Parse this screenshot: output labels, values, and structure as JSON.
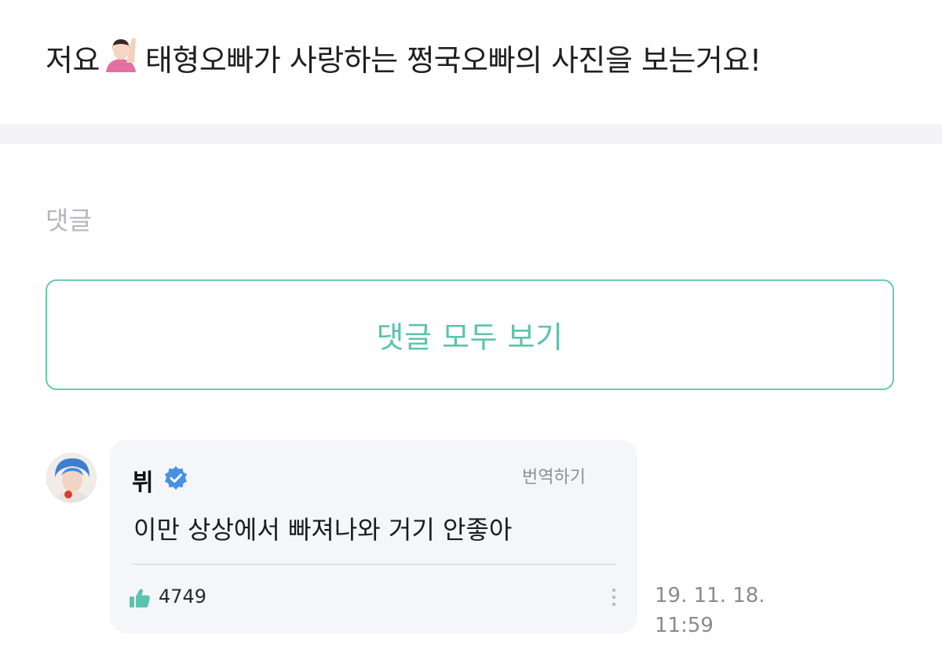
{
  "post": {
    "text_before": "저요",
    "text_after": "태형오빠가 사랑하는 쩡국오빠의 사진을 보는거요!",
    "emoji": "raising-hand-woman-emoji"
  },
  "comments": {
    "heading": "댓글",
    "view_all_label": "댓글 모두 보기",
    "items": [
      {
        "author": "뷔",
        "verified": true,
        "translate_label": "번역하기",
        "body": "이만 상상에서 빠져나와 거기 안좋아",
        "likes": "4749",
        "date": "19. 11. 18.",
        "time": "11:59"
      }
    ]
  },
  "colors": {
    "accent": "#5dc2ae",
    "verified": "#4a90e2"
  }
}
